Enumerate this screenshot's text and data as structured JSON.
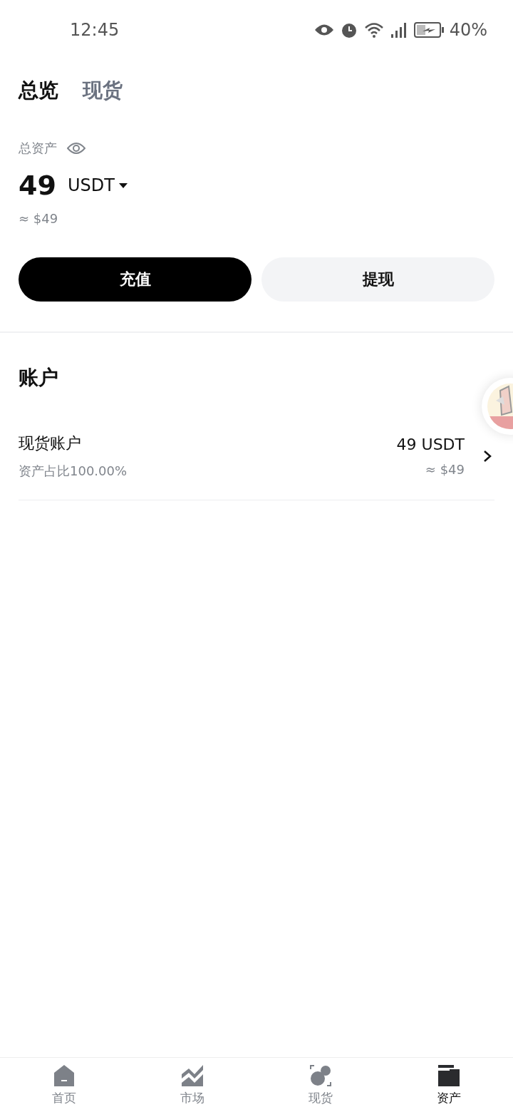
{
  "status_bar": {
    "time": "12:45",
    "battery": "40%"
  },
  "tabs": [
    {
      "label": "总览",
      "selected": true
    },
    {
      "label": "现货",
      "selected": false
    }
  ],
  "summary": {
    "label": "总资产",
    "amount": "49",
    "currency": "USDT",
    "approx": "≈ $49"
  },
  "actions": [
    {
      "label": "充值",
      "kind": "primary"
    },
    {
      "label": "提现",
      "kind": "secondary"
    }
  ],
  "accounts": {
    "title": "账户",
    "items": [
      {
        "name": "现货账户",
        "share": "资产占比100.00%",
        "amount": "49 USDT",
        "approx": "≈ $49"
      }
    ]
  },
  "bottom_nav": [
    {
      "label": "首页",
      "kind": "home",
      "selected": false
    },
    {
      "label": "市场",
      "kind": "market",
      "selected": false
    },
    {
      "label": "现货",
      "kind": "spot",
      "selected": false
    },
    {
      "label": "资产",
      "kind": "assets",
      "selected": true
    }
  ]
}
